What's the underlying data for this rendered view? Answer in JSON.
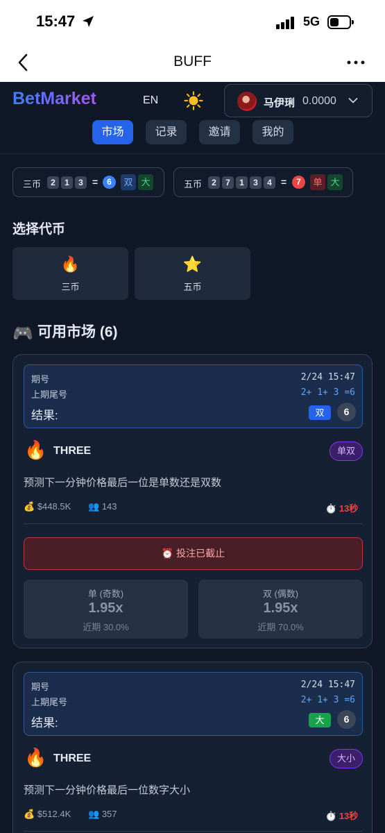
{
  "status": {
    "time": "15:47",
    "network": "5G"
  },
  "nav": {
    "title": "BUFF"
  },
  "header": {
    "brand": "BetMarket",
    "lang": "EN",
    "user_name": "马伊琍",
    "balance": "0.0000"
  },
  "tabs": [
    "市场",
    "记录",
    "邀请",
    "我的"
  ],
  "tickers": [
    {
      "label": "三币",
      "digits": [
        "2",
        "1",
        "3"
      ],
      "sum": "6",
      "tags": [
        "双",
        "大"
      ]
    },
    {
      "label": "五币",
      "digits": [
        "2",
        "7",
        "1",
        "3",
        "4"
      ],
      "sum": "7",
      "tags": [
        "单",
        "大"
      ]
    }
  ],
  "select_token": {
    "title": "选择代币",
    "cards": [
      {
        "emoji": "🔥",
        "label": "三币"
      },
      {
        "emoji": "⭐",
        "label": "五币"
      }
    ]
  },
  "markets_header": {
    "emoji": "🎮",
    "title": "可用市场 (6)"
  },
  "markets": [
    {
      "period_label": "期号",
      "period_value": "2/24 15:47",
      "prev_label": "上期尾号",
      "prev_value": "2+ 1+ 3 =6",
      "result_label": "结果:",
      "result_tag": "双",
      "result_num": "6",
      "emoji": "🔥",
      "name": "THREE",
      "type": "单双",
      "desc": "预测下一分钟价格最后一位是单数还是双数",
      "pool": "$448.5K",
      "users": "143",
      "timer": "13秒",
      "closed": "投注已截止",
      "options": [
        {
          "label": "单 (奇数)",
          "odds": "1.95x",
          "recent": "近期 30.0%"
        },
        {
          "label": "双 (偶数)",
          "odds": "1.95x",
          "recent": "近期 70.0%"
        }
      ]
    },
    {
      "period_label": "期号",
      "period_value": "2/24 15:47",
      "prev_label": "上期尾号",
      "prev_value": "2+ 1+ 3 =6",
      "result_label": "结果:",
      "result_tag": "大",
      "result_num": "6",
      "emoji": "🔥",
      "name": "THREE",
      "type": "大小",
      "desc": "预测下一分钟价格最后一位数字大小",
      "pool": "$512.4K",
      "users": "357",
      "timer": "13秒"
    }
  ],
  "icons": {
    "pool": "money-bag-icon",
    "users": "users-icon",
    "timer": "stopwatch-icon",
    "alarm": "alarm-clock-icon"
  },
  "colors": {
    "accent": "#2563eb",
    "danger": "#ef4444",
    "even_tag": "#2563eb",
    "big_tag": "#22c55e",
    "purple": "#a855f7"
  }
}
